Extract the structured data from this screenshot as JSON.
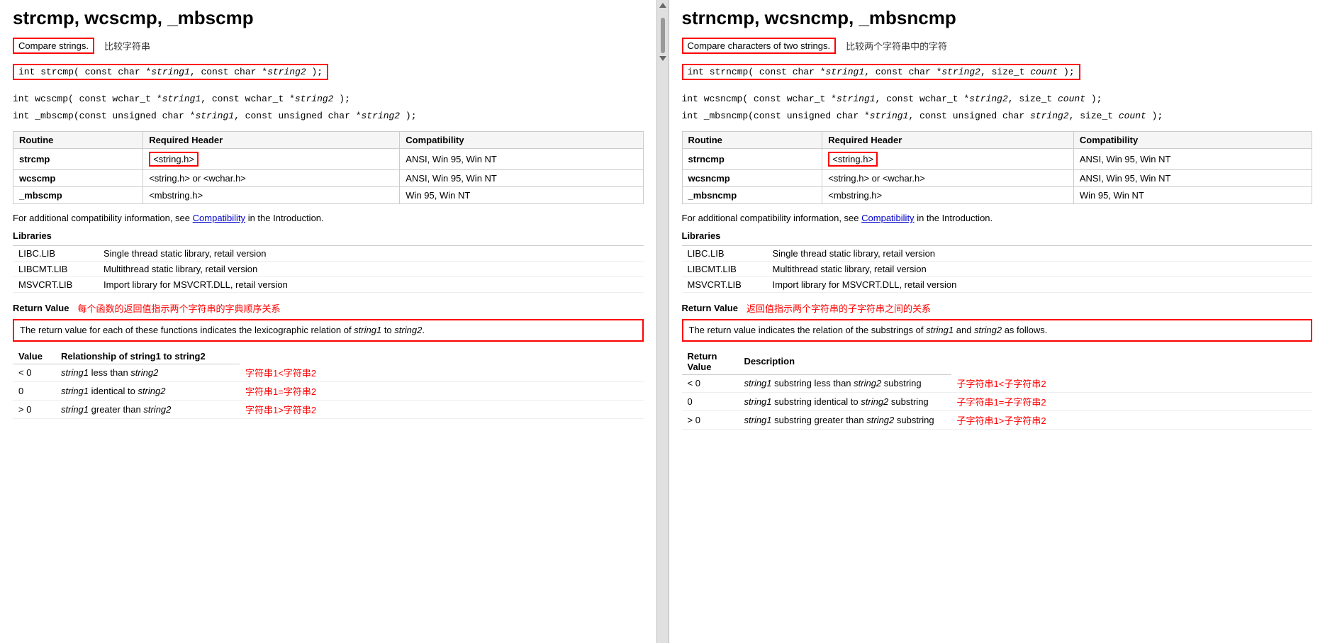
{
  "left": {
    "title": "strcmp, wcscmp, _mbscmp",
    "description_en": "Compare strings.",
    "description_zh": "比较字符串",
    "signatures": [
      {
        "text": "int strcmp( const char *string1, const char *string2 );",
        "highlighted": true
      },
      {
        "text": "int wcscmp( const wchar_t *string1, const wchar_t *string2 );",
        "highlighted": false
      },
      {
        "text": "int _mbscmp(const unsigned char *string1, const unsigned char *string2 );",
        "highlighted": false
      }
    ],
    "compat_table": {
      "headers": [
        "Routine",
        "Required Header",
        "Compatibility"
      ],
      "rows": [
        {
          "routine": "strcmp",
          "header": "<string.h>",
          "header_boxed": true,
          "compat": "ANSI, Win 95, Win NT"
        },
        {
          "routine": "wcscmp",
          "header": "<string.h> or <wchar.h>",
          "header_boxed": false,
          "compat": "ANSI, Win 95, Win NT"
        },
        {
          "routine": "_mbscmp",
          "header": "<mbstring.h>",
          "header_boxed": false,
          "compat": "Win 95, Win NT"
        }
      ]
    },
    "compat_note": "For additional compatibility information, see",
    "compat_link": "Compatibility",
    "compat_note2": "in the Introduction.",
    "libraries_title": "Libraries",
    "libraries": [
      {
        "name": "LIBC.LIB",
        "desc": "Single thread static library, retail version"
      },
      {
        "name": "LIBCMT.LIB",
        "desc": "Multithread static library, retail version"
      },
      {
        "name": "MSVCRT.LIB",
        "desc": "Import library for MSVCRT.DLL, retail version"
      }
    ],
    "return_label": "Return Value",
    "return_chinese": "每个函数的返回值指示两个字符串的字典顺序关系",
    "return_desc": "The return value for each of these functions indicates the lexicographic relation of string1 to string2.",
    "return_desc_italic_parts": [
      "string1",
      "string2"
    ],
    "value_table": {
      "headers": [
        "Value",
        "Relationship of string1 to string2"
      ],
      "rows": [
        {
          "value": "< 0",
          "relation": "string1 less than string2",
          "chinese": "字符串1<字符串2"
        },
        {
          "value": "0",
          "relation": "string1 identical to string2",
          "chinese": "字符串1=字符串2"
        },
        {
          "value": "> 0",
          "relation": "string1 greater than string2",
          "chinese": "字符串1>字符串2"
        }
      ]
    }
  },
  "right": {
    "title": "strncmp, wcsncmp, _mbsncmp",
    "description_en": "Compare characters of two strings.",
    "description_zh": "比较两个字符串中的字符",
    "signatures": [
      {
        "text": "int strncmp( const char *string1, const char *string2, size_t count );",
        "highlighted": true
      },
      {
        "text": "int wcsncmp( const wchar_t *string1, const wchar_t *string2, size_t count );",
        "highlighted": false
      },
      {
        "text": "int _mbsncmp(const unsigned char *string1, const unsigned char string2, size_t count );",
        "highlighted": false
      }
    ],
    "compat_table": {
      "headers": [
        "Routine",
        "Required Header",
        "Compatibility"
      ],
      "rows": [
        {
          "routine": "strncmp",
          "header": "<string.h>",
          "header_boxed": true,
          "compat": "ANSI, Win 95, Win NT"
        },
        {
          "routine": "wcsncmp",
          "header": "<string.h> or <wchar.h>",
          "header_boxed": false,
          "compat": "ANSI, Win 95, Win NT"
        },
        {
          "routine": "_mbsncmp",
          "header": "<mbstring.h>",
          "header_boxed": false,
          "compat": "Win 95, Win NT"
        }
      ]
    },
    "compat_note": "For additional compatibility information, see",
    "compat_link": "Compatibility",
    "compat_note2": "in the Introduction.",
    "libraries_title": "Libraries",
    "libraries": [
      {
        "name": "LIBC.LIB",
        "desc": "Single thread static library, retail version"
      },
      {
        "name": "LIBCMT.LIB",
        "desc": "Multithread static library, retail version"
      },
      {
        "name": "MSVCRT.LIB",
        "desc": "Import library for MSVCRT.DLL, retail version"
      }
    ],
    "return_label": "Return Value",
    "return_chinese": "返回值指示两个字符串的子字符串之间的关系",
    "return_desc": "The return value indicates the relation of the substrings of string1 and string2 as follows.",
    "value_table": {
      "headers": [
        "Return Value",
        "Description"
      ],
      "rows": [
        {
          "value": "< 0",
          "relation": "string1 substring less than string2 substring",
          "chinese": "子字符串1<子字符串2"
        },
        {
          "value": "0",
          "relation": "string1 substring identical to string2 substring",
          "chinese": "子字符串1=子字符串2"
        },
        {
          "value": "> 0",
          "relation": "string1 substring greater than string2 substring",
          "chinese": "子字符串1>子字符串2"
        }
      ]
    }
  }
}
